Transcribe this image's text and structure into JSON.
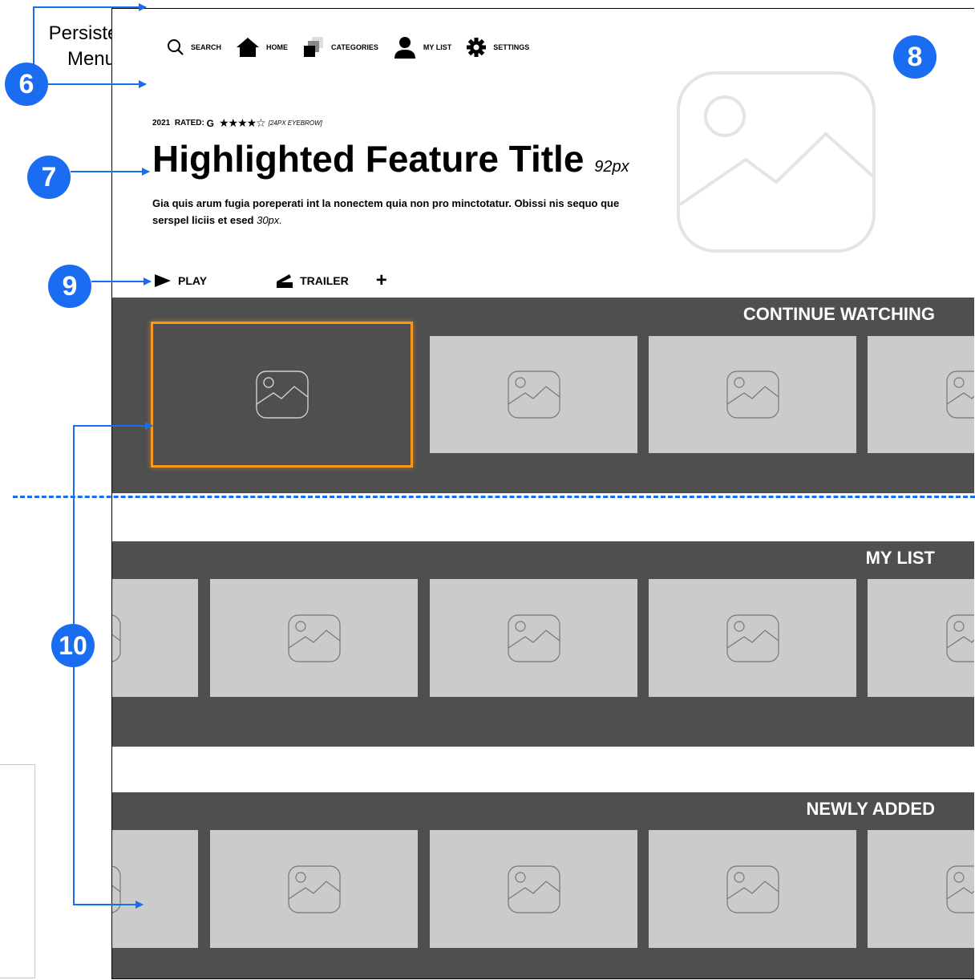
{
  "nav": {
    "items": [
      {
        "label": "SEARCH",
        "icon": "search-icon"
      },
      {
        "label": "HOME",
        "icon": "home-icon"
      },
      {
        "label": "CATEGORIES",
        "icon": "categories-icon"
      },
      {
        "label": "MY LIST",
        "icon": "user-icon"
      },
      {
        "label": "SETTINGS",
        "icon": "gear-icon"
      }
    ]
  },
  "feature": {
    "year": "2021",
    "rated_label": "RATED:",
    "rating": "G",
    "stars": "★★★★☆",
    "eyebrow_note": "[24PX EYEBROW]",
    "title": "Highlighted Feature Title",
    "title_size_note": "92px",
    "description": "Gia quis arum fugia poreperati int la nonectem quia non pro minctotatur. Obissi nis sequo que serspel liciis et esed",
    "description_size_note": "30px.",
    "play_label": "PLAY",
    "trailer_label": "TRAILER",
    "add_label": "+"
  },
  "rows": [
    {
      "title": "CONTINUE WATCHING"
    },
    {
      "title": "MY LIST"
    },
    {
      "title": "NEWLY ADDED"
    }
  ],
  "annotations": {
    "persistent_menu": "Persistent Menu",
    "badge_6": "6",
    "badge_7": "7",
    "badge_8": "8",
    "badge_9": "9",
    "badge_10": "10"
  },
  "colors": {
    "annotation_blue": "#1a6cf0",
    "row_background": "#4f4f4f",
    "tile_background": "#cbcbcb",
    "focus_outline": "#f39a1e"
  }
}
